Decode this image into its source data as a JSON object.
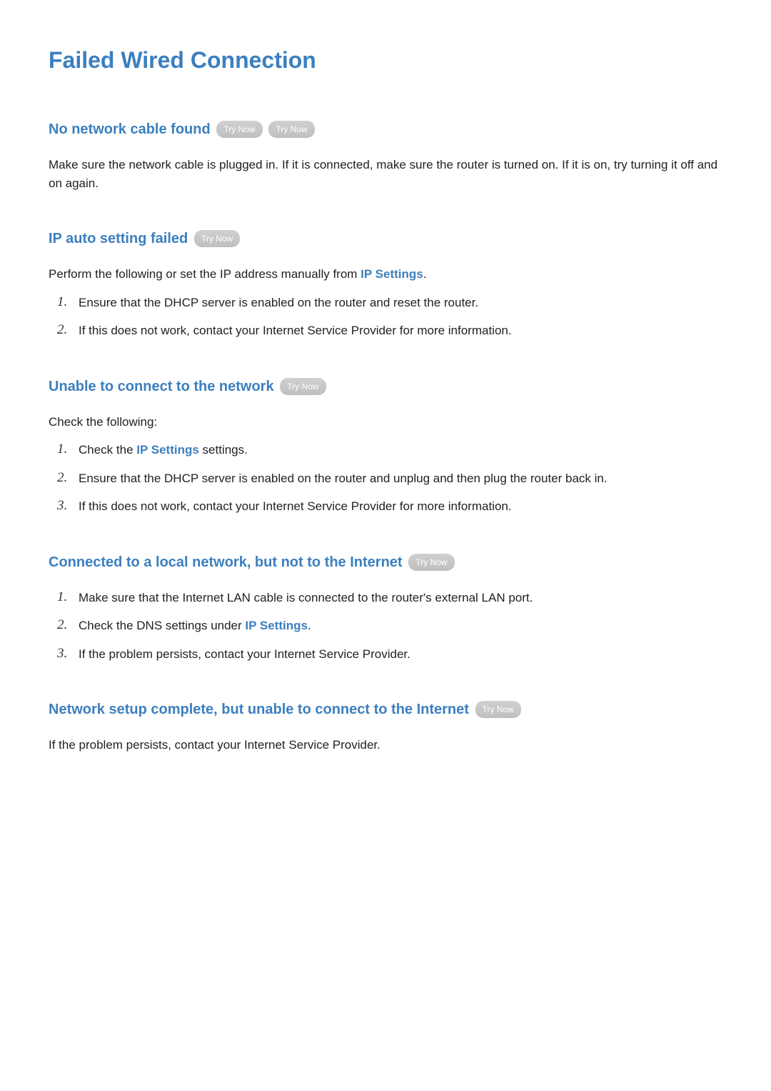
{
  "page": {
    "title": "Failed Wired Connection"
  },
  "labels": {
    "try_now": "Try Now",
    "ip_settings": "IP Settings"
  },
  "sections": {
    "no_cable": {
      "heading": "No network cable found",
      "body": "Make sure the network cable is plugged in. If it is connected, make sure the router is turned on. If it is on, try turning it off and on again."
    },
    "ip_auto": {
      "heading": "IP auto setting failed",
      "intro_prefix": "Perform the following or set the IP address manually from ",
      "intro_suffix": ".",
      "items": [
        "Ensure that the DHCP server is enabled on the router and reset the router.",
        "If this does not work, contact your Internet Service Provider for more information."
      ]
    },
    "unable_connect": {
      "heading": "Unable to connect to the network",
      "intro": "Check the following:",
      "item1_prefix": "Check the ",
      "item1_suffix": " settings.",
      "item2": "Ensure that the DHCP server is enabled on the router and unplug and then plug the router back in.",
      "item3": "If this does not work, contact your Internet Service Provider for more information."
    },
    "local_not_internet": {
      "heading": "Connected to a local network, but not to the Internet",
      "item1": "Make sure that the Internet LAN cable is connected to the router's external LAN port.",
      "item2_prefix": "Check the DNS settings under ",
      "item2_suffix": ".",
      "item3": "If the problem persists, contact your Internet Service Provider."
    },
    "setup_complete": {
      "heading": "Network setup complete, but unable to connect to the Internet",
      "body": "If the problem persists, contact your Internet Service Provider."
    }
  }
}
